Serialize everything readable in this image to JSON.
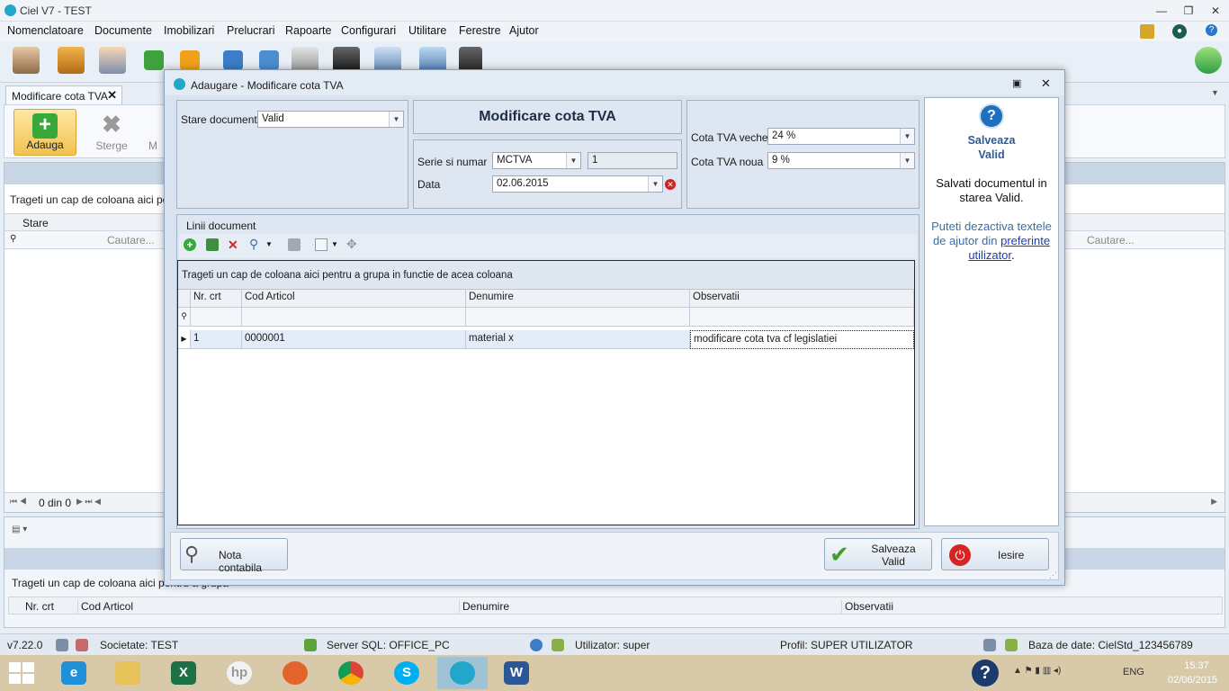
{
  "app": {
    "title": "Ciel V7 - TEST"
  },
  "menu": [
    "Nomenclatoare",
    "Documente",
    "Imobilizari",
    "Prelucrari",
    "Rapoarte",
    "Configurari",
    "Utilitare",
    "Ferestre",
    "Ajutor"
  ],
  "doc_tab": {
    "label": "Modificare cota TVA"
  },
  "ribbon": {
    "add": "Adauga",
    "delete": "Sterge",
    "more": "M"
  },
  "background": {
    "group_hint": "Trageti un cap de coloana aici pentru",
    "col_stare": "Stare",
    "search_placeholder": "Cautare...",
    "search_placeholder_right": "Cautare...",
    "pager": "0 din 0",
    "group_hint2": "Trageti un cap de coloana aici pentru a grupa",
    "cols2": [
      "Nr. crt",
      "Cod Articol",
      "Denumire",
      "Observatii"
    ]
  },
  "dialog": {
    "title": "Adaugare - Modificare cota TVA",
    "heading": "Modificare cota TVA",
    "stare_label": "Stare document",
    "stare_value": "Valid",
    "serie_label": "Serie si numar",
    "serie_value": "MCTVA",
    "numar_value": "1",
    "data_label": "Data",
    "data_value": "02.06.2015",
    "cota_veche_label": "Cota TVA veche",
    "cota_veche_value": "24 %",
    "cota_noua_label": "Cota TVA noua",
    "cota_noua_value": "9 %",
    "lines_title": "Linii document",
    "group_hint": "Trageti un cap de coloana aici pentru a grupa in functie de acea coloana",
    "columns": [
      "Nr. crt",
      "Cod Articol",
      "Denumire",
      "Observatii"
    ],
    "row": {
      "nr": "1",
      "cod": "0000001",
      "denumire": "material x",
      "observatii": "modificare cota tva cf legislatiei"
    },
    "help": {
      "title_1": "Salveaza",
      "title_2": "Valid",
      "text1": "Salvati documentul in starea Valid.",
      "text2_a": "Puteti dezactiva textele de ajutor din",
      "text2_link": "preferinte utilizator",
      "text2_b": "."
    },
    "btn_nota": "Nota contabila",
    "btn_save_1": "Salveaza",
    "btn_save_2": "Valid",
    "btn_exit": "Iesire"
  },
  "status": {
    "version": "v7.22.0",
    "societate": "Societate: TEST",
    "server": "Server SQL: OFFICE_PC",
    "utilizator": "Utilizator: super",
    "profil": "Profil: SUPER UTILIZATOR",
    "baza": "Baza de date: CielStd_123456789"
  },
  "taskbar": {
    "lang": "ENG",
    "time": "15:37",
    "date": "02/06/2015"
  }
}
